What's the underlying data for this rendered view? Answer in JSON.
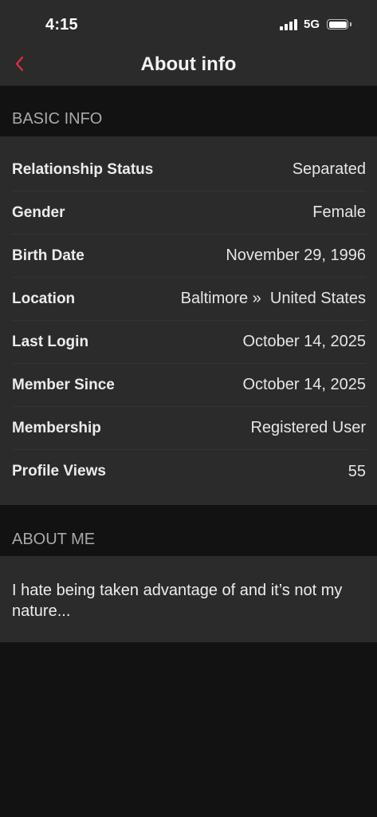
{
  "status_bar": {
    "time": "4:15",
    "network": "5G",
    "signal_bars": 4,
    "icons": [
      "signal-icon",
      "battery-icon"
    ]
  },
  "nav": {
    "back_icon": "chevron-left-icon",
    "title": "About info",
    "accent_color": "#e0303b"
  },
  "basic_info": {
    "header": "BASIC INFO",
    "rows": [
      {
        "label": "Relationship Status",
        "value": "Separated"
      },
      {
        "label": "Gender",
        "value": "Female"
      },
      {
        "label": "Birth Date",
        "value": "November 29, 1996"
      },
      {
        "label": "Location",
        "value": "Baltimore »  United States"
      },
      {
        "label": "Last Login",
        "value": "October 14, 2025"
      },
      {
        "label": "Member Since",
        "value": "October 14, 2025"
      },
      {
        "label": "Membership",
        "value": "Registered User"
      },
      {
        "label": "Profile Views",
        "value": "55"
      }
    ]
  },
  "about_me": {
    "header": "ABOUT ME",
    "text": "I hate being taken advantage of and it’s not my nature..."
  }
}
